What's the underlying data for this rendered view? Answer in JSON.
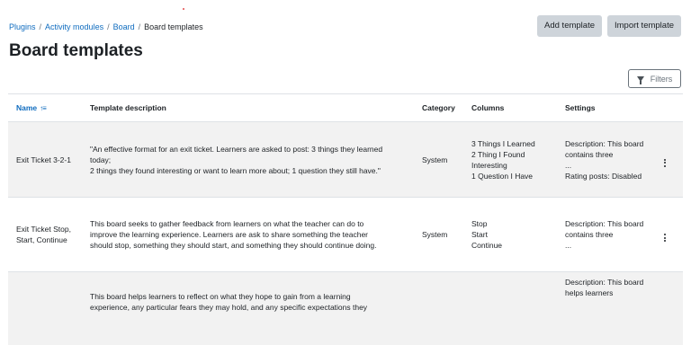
{
  "breadcrumb": {
    "items": [
      "Plugins",
      "Activity modules",
      "Board"
    ],
    "separator": "/",
    "current": "Board templates"
  },
  "header": {
    "title": "Board templates",
    "add_template": "Add template",
    "import_template": "Import template",
    "filters": "Filters"
  },
  "table": {
    "headers": {
      "name": "Name",
      "description": "Template description",
      "category": "Category",
      "columns": "Columns",
      "settings": "Settings"
    },
    "rows": [
      {
        "name": "Exit Ticket 3-2-1",
        "description": "\"An effective format for an exit ticket. Learners are asked to post: 3 things they learned today;\n2 things they found interesting or want to learn more about; 1 question they still have.\"",
        "category": "System",
        "columns": "3 Things I Learned\n2 Thing I Found Interesting\n1 Question I Have",
        "settings": "Description: This board contains three\n...\nRating posts: Disabled"
      },
      {
        "name": "Exit Ticket Stop, Start, Continue",
        "description": "This board seeks to gather feedback from learners on what the teacher can do to improve the learning experience. Learners are ask to share something the teacher should stop, something they should start, and something they should continue doing.",
        "category": "System",
        "columns": "Stop\nStart\nContinue",
        "settings": "Description: This board contains three\n..."
      },
      {
        "name": "",
        "description": "This board helps learners to reflect on what they hope to gain from a learning experience, any particular fears they may hold, and any specific expectations they",
        "category": "",
        "columns": "",
        "settings": "Description: This board helps learners"
      }
    ]
  },
  "colors": {
    "link": "#0f6cbf",
    "button_bg": "#ced4da",
    "row_alt": "#f2f2f2",
    "border": "#dee2e6"
  }
}
